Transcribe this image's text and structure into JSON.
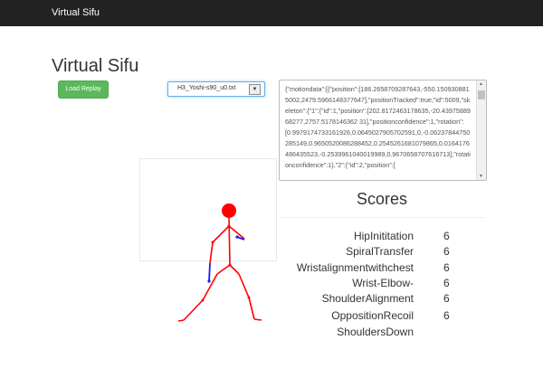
{
  "navbar": {
    "brand": "Virtual Sifu"
  },
  "page": {
    "title": "Virtual Sifu"
  },
  "controls": {
    "load_button": "Load Replay",
    "file_select_value": "H3_Yoshi-s90_u0.txt"
  },
  "motion_json": "{\"motiondata\":[{\"position\":[186.2658709287643,-550.1509308815002,2479.5966148377647],\"positionTracked\":true,\"id\":5009,\"skeleton\":{\"1\":{\"id\":1,\"position\":[202.8172463178635,-20.4397588968277,2757.5178146362 31],\"positionconfidence\":1,\"rotation\":[0.9979174733161926,0.0645027905702591,0,-0.06237844750285149,0.9650520086288452,0.2545261681079865,0.0164176486435523,-0.2539961040019989,0.9670658707616713],\"rotationconfidence\":1},\"2\":{\"id\":2,\"position\":[",
  "scores": {
    "title": "Scores",
    "items": [
      {
        "name": "HipInititation",
        "value": "6"
      },
      {
        "name": "SpiralTransfer",
        "value": "6"
      },
      {
        "name": "Wristalignmentwithchest",
        "value": "6"
      },
      {
        "name": "Wrist-Elbow-",
        "value": "6"
      },
      {
        "name": "ShoulderAlignment",
        "value": "6"
      },
      {
        "name": "OppositionRecoil",
        "value": "6"
      },
      {
        "name": "ShouldersDown",
        "value": ""
      }
    ]
  },
  "colors": {
    "skeleton": "#ff0000",
    "hand": "#1a1aff",
    "button": "#5cb85c",
    "navbar": "#222222"
  }
}
